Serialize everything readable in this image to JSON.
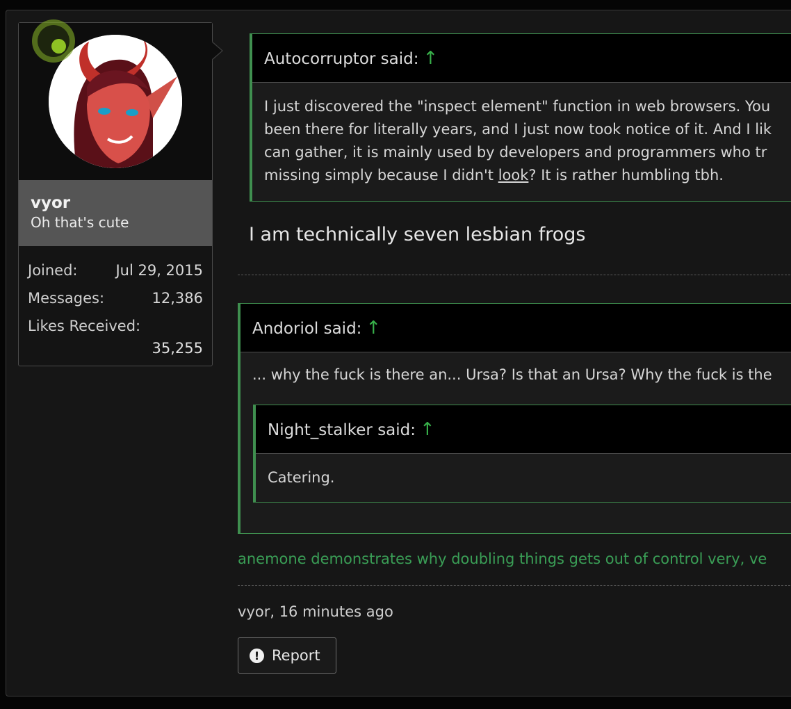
{
  "user": {
    "name": "vyor",
    "title": "Oh that's cute",
    "stats": {
      "joined_label": "Joined:",
      "joined_value": "Jul 29, 2015",
      "messages_label": "Messages:",
      "messages_value": "12,386",
      "likes_label": "Likes Received:",
      "likes_value": "35,255"
    },
    "online_indicator_color": "#8ec124"
  },
  "quotes": [
    {
      "author_said": "Autocorruptor said:",
      "lines": [
        "I just discovered the \"inspect element\" function in web browsers. You",
        "been there for literally years, and I just now took notice of it. And I lik",
        "can gather, it is mainly used by developers and programmers who tr"
      ],
      "last_line_before": "missing simply because I didn't ",
      "last_line_link": "look",
      "last_line_after": "? It is rather humbling tbh."
    },
    {
      "author_said": "Andoriol said:",
      "text": "... why the fuck is there an... Ursa? Is that an Ursa? Why the fuck is the"
    },
    {
      "author_said": "Night_stalker said:",
      "text": "Catering."
    }
  ],
  "up_arrow": "↑",
  "post_text": "I am technically seven lesbian frogs",
  "signature": "anemone demonstrates why doubling things gets out of control very, ve",
  "meta": "vyor, 16 minutes ago",
  "report_label": "Report",
  "report_icon_glyph": "!",
  "colors": {
    "accent_green": "#3f8f4f",
    "signature_green": "#3a9e56",
    "background": "#161616"
  }
}
